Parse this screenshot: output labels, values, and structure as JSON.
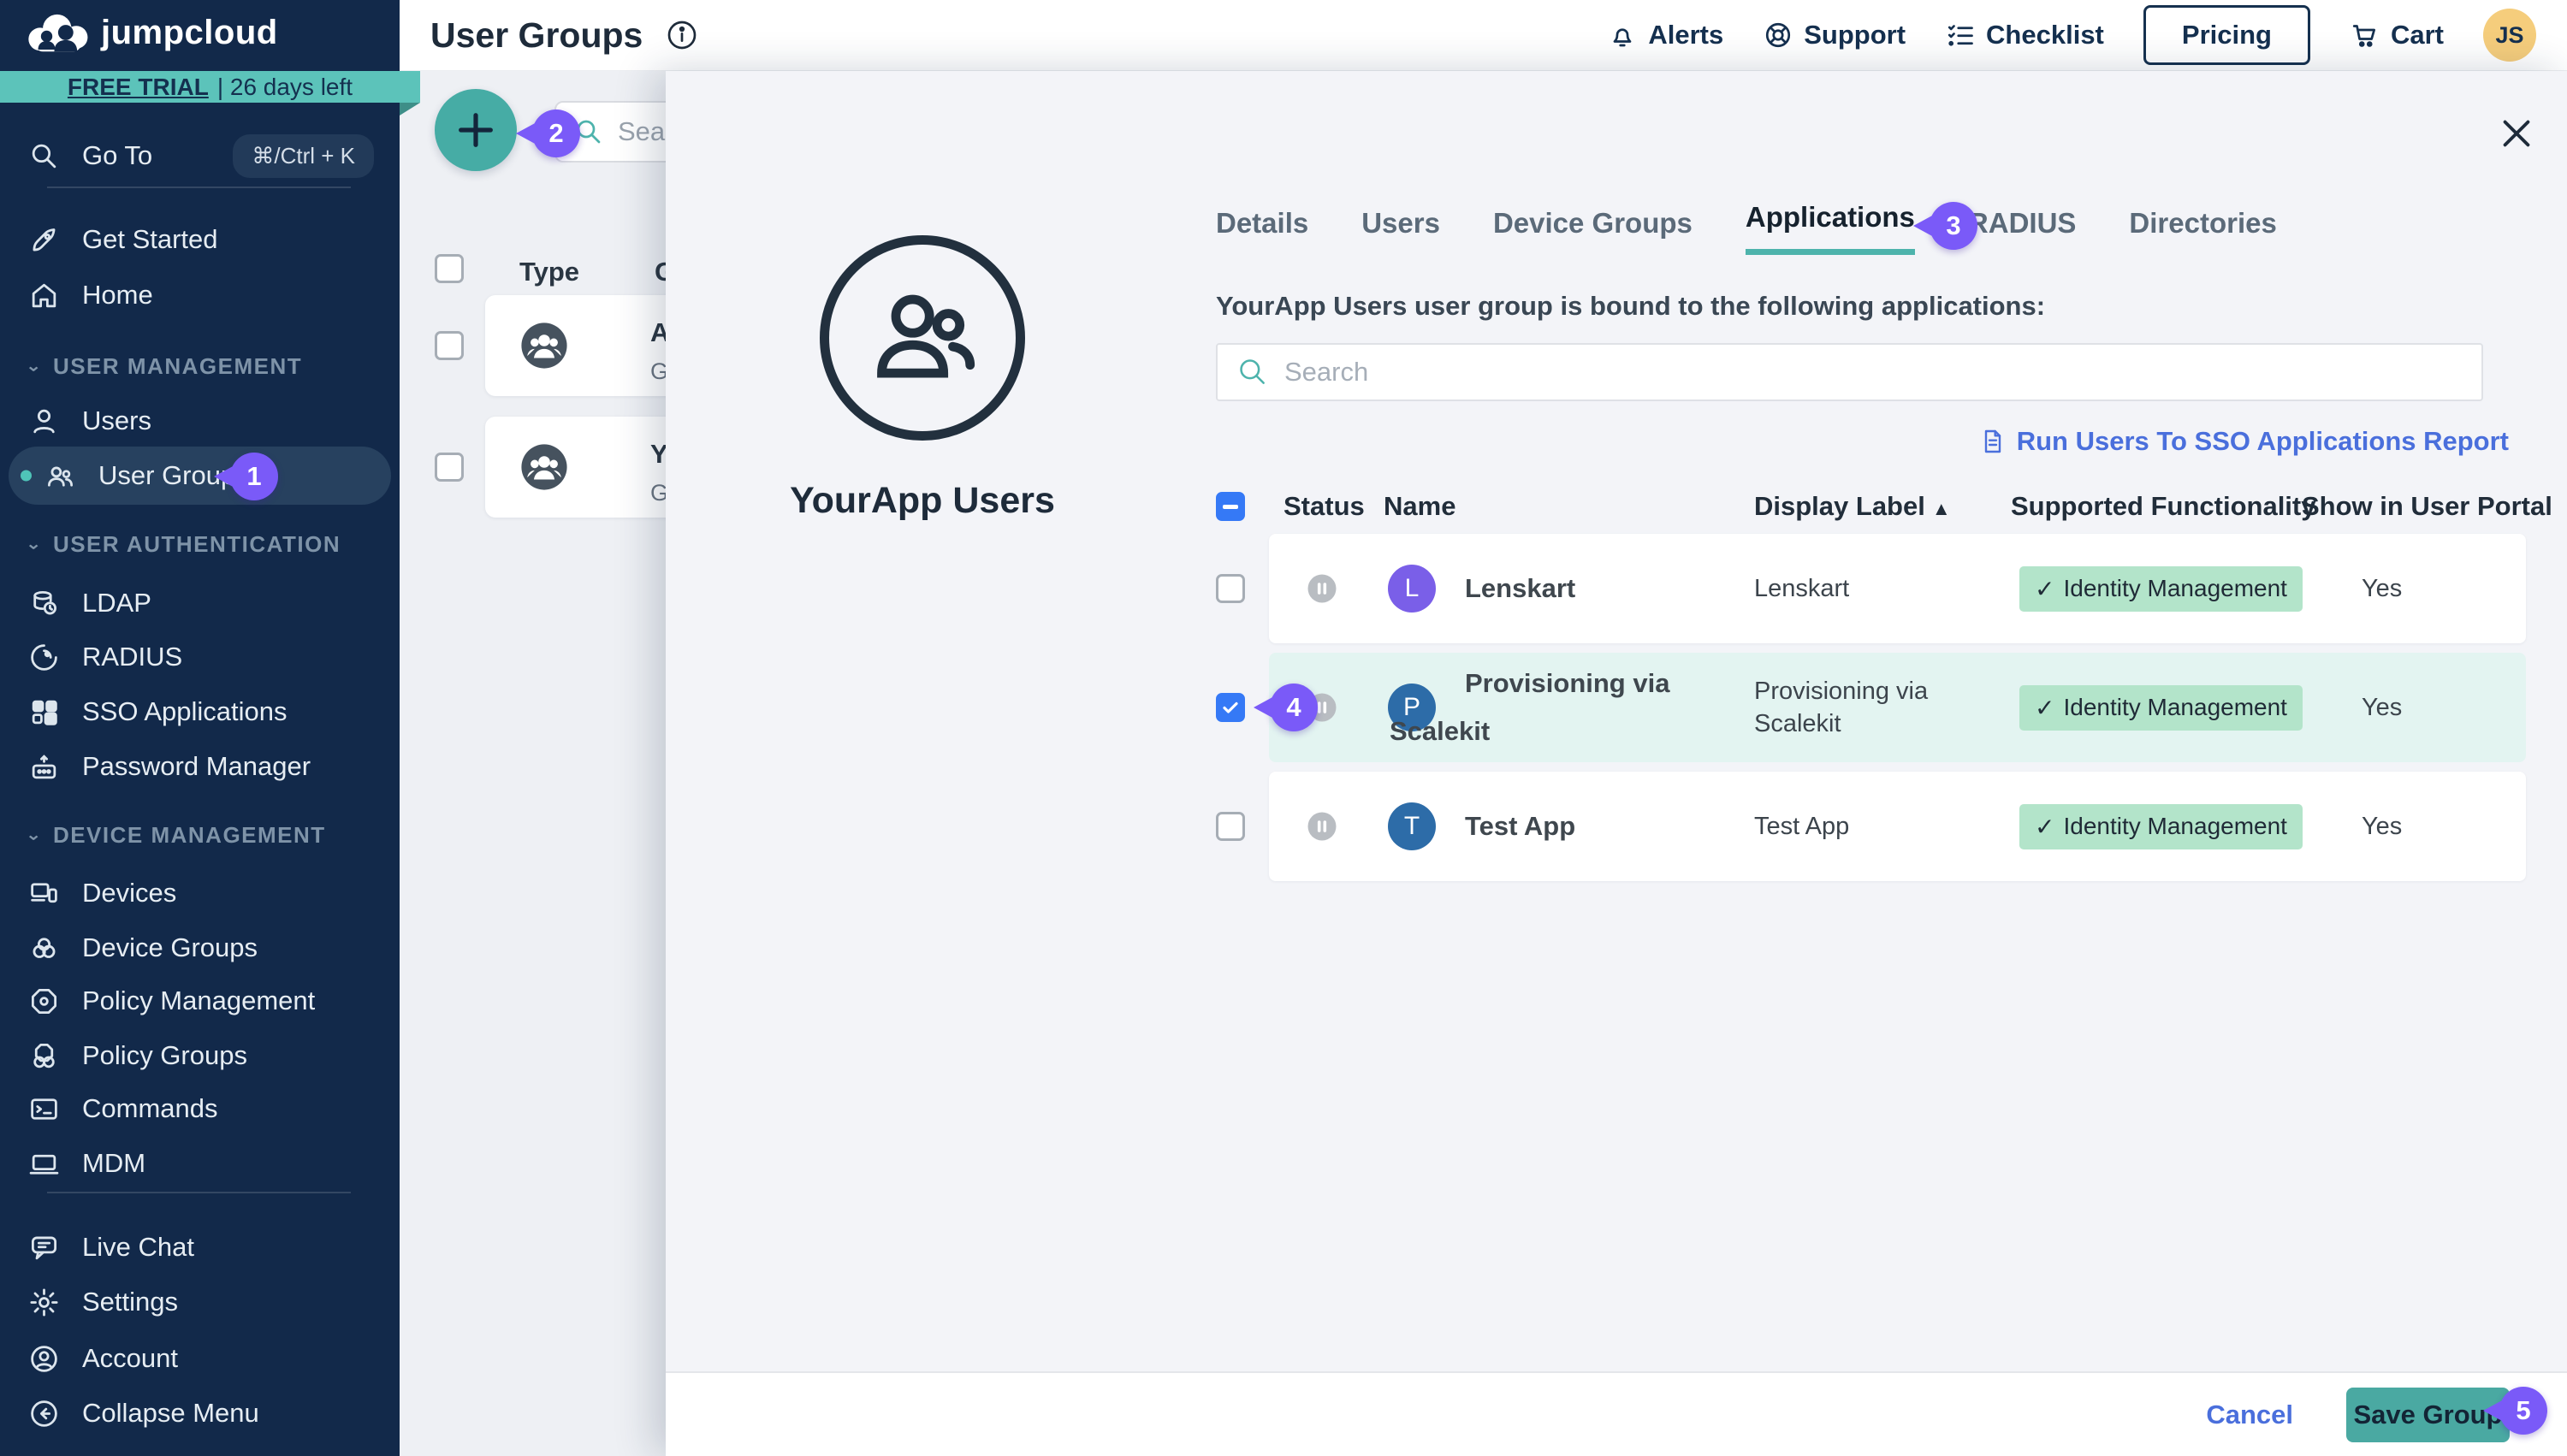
{
  "brand": {
    "name": "jumpcloud"
  },
  "trial": {
    "highlight": "FREE TRIAL",
    "rest": "| 26 days left"
  },
  "sidebar": {
    "goto": {
      "label": "Go To",
      "shortcut": "⌘/Ctrl + K"
    },
    "get_started": "Get Started",
    "home": "Home",
    "sec_user_mgmt": "USER MANAGEMENT",
    "users": "Users",
    "user_groups": "User Groups",
    "sec_user_auth": "USER AUTHENTICATION",
    "ldap": "LDAP",
    "radius": "RADIUS",
    "sso": "SSO Applications",
    "password_manager": "Password Manager",
    "sec_device_mgmt": "DEVICE MANAGEMENT",
    "devices": "Devices",
    "device_groups": "Device Groups",
    "policy_mgmt": "Policy Management",
    "policy_groups": "Policy Groups",
    "commands": "Commands",
    "mdm": "MDM",
    "live_chat": "Live Chat",
    "settings": "Settings",
    "account": "Account",
    "collapse": "Collapse Menu"
  },
  "header": {
    "title": "User Groups",
    "alerts": "Alerts",
    "support": "Support",
    "checklist": "Checklist",
    "pricing": "Pricing",
    "cart": "Cart",
    "avatar_initials": "JS"
  },
  "backdrop": {
    "search_placeholder": "Search",
    "col_type": "Type",
    "col_group": "G",
    "rows": [
      {
        "name": "A",
        "sub": "G"
      },
      {
        "name": "Y",
        "sub": "G"
      }
    ]
  },
  "panel": {
    "group_name": "YourApp Users",
    "tabs": {
      "details": "Details",
      "users": "Users",
      "device_groups": "Device Groups",
      "applications": "Applications",
      "radius": "RADIUS",
      "directories": "Directories"
    },
    "description": "YourApp Users user group is bound to the following applications:",
    "search_placeholder": "Search",
    "report_link": "Run Users To SSO Applications Report",
    "columns": {
      "status": "Status",
      "name": "Name",
      "display_label": "Display Label",
      "functionality": "Supported Functionality",
      "portal": "Show in User Portal"
    },
    "sort_icon": "▲",
    "check_glyph": "✓",
    "rows": [
      {
        "initial": "L",
        "name": "Lenskart",
        "display_label": "Lenskart",
        "functionality": "Identity Management",
        "portal": "Yes",
        "checked": false
      },
      {
        "initial": "P",
        "name": "Provisioning via Scalekit",
        "display_label": "Provisioning via Scalekit",
        "functionality": "Identity Management",
        "portal": "Yes",
        "checked": true
      },
      {
        "initial": "T",
        "name": "Test App",
        "display_label": "Test App",
        "functionality": "Identity Management",
        "portal": "Yes",
        "checked": false
      }
    ],
    "footer": {
      "cancel": "Cancel",
      "save": "Save Group"
    }
  },
  "annotations": {
    "s1": "1",
    "s2": "2",
    "s3": "3",
    "s4": "4",
    "s5": "5"
  },
  "colors": {
    "sidebar_bg": "#12294A",
    "teal_accent": "#4DB3AC",
    "trial_banner": "#5CC3BA",
    "step_purple": "#7A5AF8",
    "checkbox_blue": "#3579F6",
    "badge_green": "#B3E4CA",
    "row_highlight": "#E3F4F1",
    "link_blue": "#4A6FDC",
    "avatar_purple": "#7A5FE8",
    "avatar_blue": "#2D6CA8",
    "js_avatar": "#F5CD7C"
  }
}
